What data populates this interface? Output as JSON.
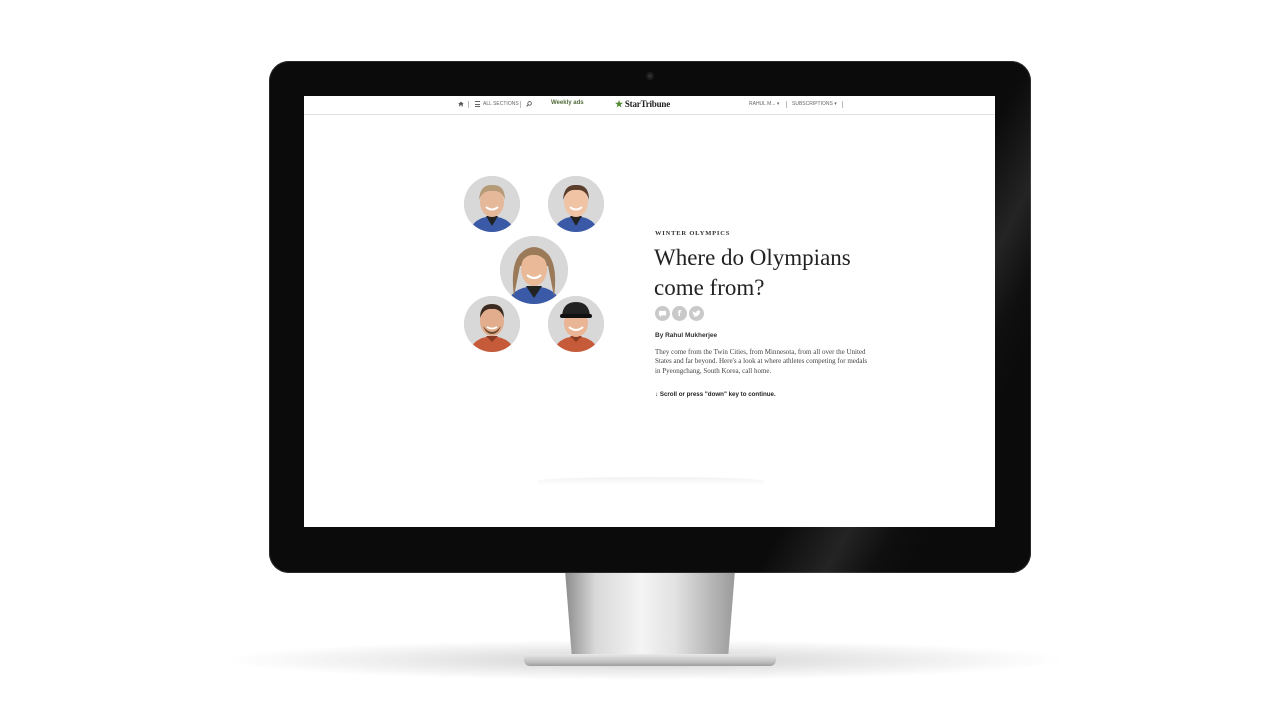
{
  "nav": {
    "all_sections": "ALL SECTIONS",
    "weekly_ads": "Weekly ads",
    "logo_text": "StarTribune",
    "user": "RAHUL M... ▾",
    "subscriptions": "SUBSCRIPTIONS ▾"
  },
  "article": {
    "kicker": "WINTER OLYMPICS",
    "headline": "Where do Olympians come from?",
    "byline": "By Rahul Mukherjee",
    "dek": "They come from the Twin Cities, from Minnesota, from all over the United States and far beyond. Here's a look at where athletes competing for medals in Pyeongchang, South Korea, call home.",
    "scroll_hint": "↓ Scroll or press \"down\" key to continue."
  },
  "colors": {
    "brand_green": "#4f8a2e",
    "weekly_ads_green": "#4f6b3a",
    "share_icon_gray": "#c9c9c9",
    "jersey_blue": "#3a5aa8",
    "jersey_orange": "#c65b3a"
  },
  "icons": [
    "home-icon",
    "menu-icon",
    "search-icon",
    "star-logo-icon",
    "comment-icon",
    "facebook-icon",
    "twitter-icon"
  ]
}
